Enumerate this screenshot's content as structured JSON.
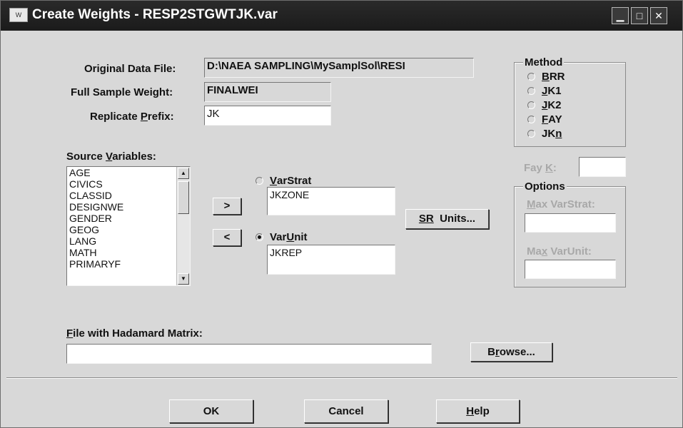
{
  "window": {
    "title": "Create Weights - RESP2STGWTJK.var",
    "app_icon_text": "W"
  },
  "form": {
    "original_label": "Original Data File:",
    "original_value": "D:\\NAEA SAMPLING\\MySamplSol\\RESI",
    "fullweight_label": "Full Sample Weight:",
    "fullweight_value": "FINALWEI",
    "prefix_label_a": "Replicate ",
    "prefix_label_u": "P",
    "prefix_label_b": "refix:",
    "prefix_value": "JK"
  },
  "method": {
    "legend": "Method",
    "options": [
      {
        "pre": "",
        "u": "B",
        "post": "RR"
      },
      {
        "pre": "",
        "u": "J",
        "post": "K1"
      },
      {
        "pre": "",
        "u": "J",
        "post": "K2"
      },
      {
        "pre": "",
        "u": "F",
        "post": "AY"
      },
      {
        "pre": "JK",
        "u": "n",
        "post": ""
      }
    ]
  },
  "fay": {
    "label_a": "Fay ",
    "label_u": "K",
    "label_b": ":",
    "value": ""
  },
  "options": {
    "legend": "Options",
    "maxstrat_label_u": "M",
    "maxstrat_label_b": "ax VarStrat:",
    "maxstrat_value": "",
    "maxunit_label_a": "Ma",
    "maxunit_label_u": "x",
    "maxunit_label_b": " VarUnit:",
    "maxunit_value": ""
  },
  "source": {
    "label_a": "Source ",
    "label_u": "V",
    "label_b": "ariables:",
    "items": [
      "AGE",
      "CIVICS",
      "CLASSID",
      "DESIGNWE",
      "GENDER",
      "GEOG",
      "LANG",
      "MATH",
      "PRIMARYF"
    ]
  },
  "buttons": {
    "add": ">",
    "remove": "<",
    "sr_u": "SR",
    "sr_rest": "  Units...",
    "browse_a": "B",
    "browse_u": "r",
    "browse_b": "owse...",
    "ok": "OK",
    "cancel": "Cancel",
    "help_u": "H",
    "help_b": "elp"
  },
  "varstrat": {
    "label_u": "V",
    "label_b": "arStrat",
    "value": "JKZONE",
    "selected": false
  },
  "varunit": {
    "label_a": "Var",
    "label_u": "U",
    "label_b": "nit",
    "value": "JKREP",
    "selected": true
  },
  "hadamard": {
    "label_u": "F",
    "label_b": "ile with Hadamard Matrix:",
    "value": ""
  }
}
